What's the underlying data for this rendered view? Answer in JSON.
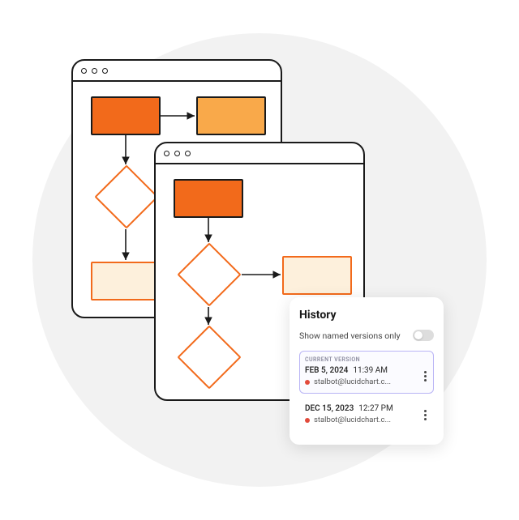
{
  "history": {
    "title": "History",
    "toggle_label": "Show named versions only",
    "toggle_on": false,
    "current_badge": "CURRENT VERSION",
    "versions": [
      {
        "date": "FEB 5, 2024",
        "time": "11:39 AM",
        "user": "stalbot@lucidchart.c...",
        "current": true
      },
      {
        "date": "DEC 15, 2023",
        "time": "12:27 PM",
        "user": "stalbot@lucidchart.c...",
        "current": false
      }
    ]
  },
  "colors": {
    "orange_dark": "#f26a1b",
    "orange_mid": "#f9a94a",
    "orange_stroke": "#f26a1b",
    "cream": "#fdf0dc",
    "ink": "#1a1a1a"
  },
  "diagram_a": {
    "shapes": [
      "process",
      "process",
      "decision",
      "process"
    ],
    "connections": [
      [
        "A",
        "B"
      ],
      [
        "A",
        "C"
      ],
      [
        "C",
        "D"
      ]
    ]
  },
  "diagram_b": {
    "shapes": [
      "process",
      "decision",
      "process",
      "decision"
    ],
    "connections": [
      [
        "A",
        "B"
      ],
      [
        "B",
        "C"
      ],
      [
        "B",
        "D"
      ]
    ]
  }
}
